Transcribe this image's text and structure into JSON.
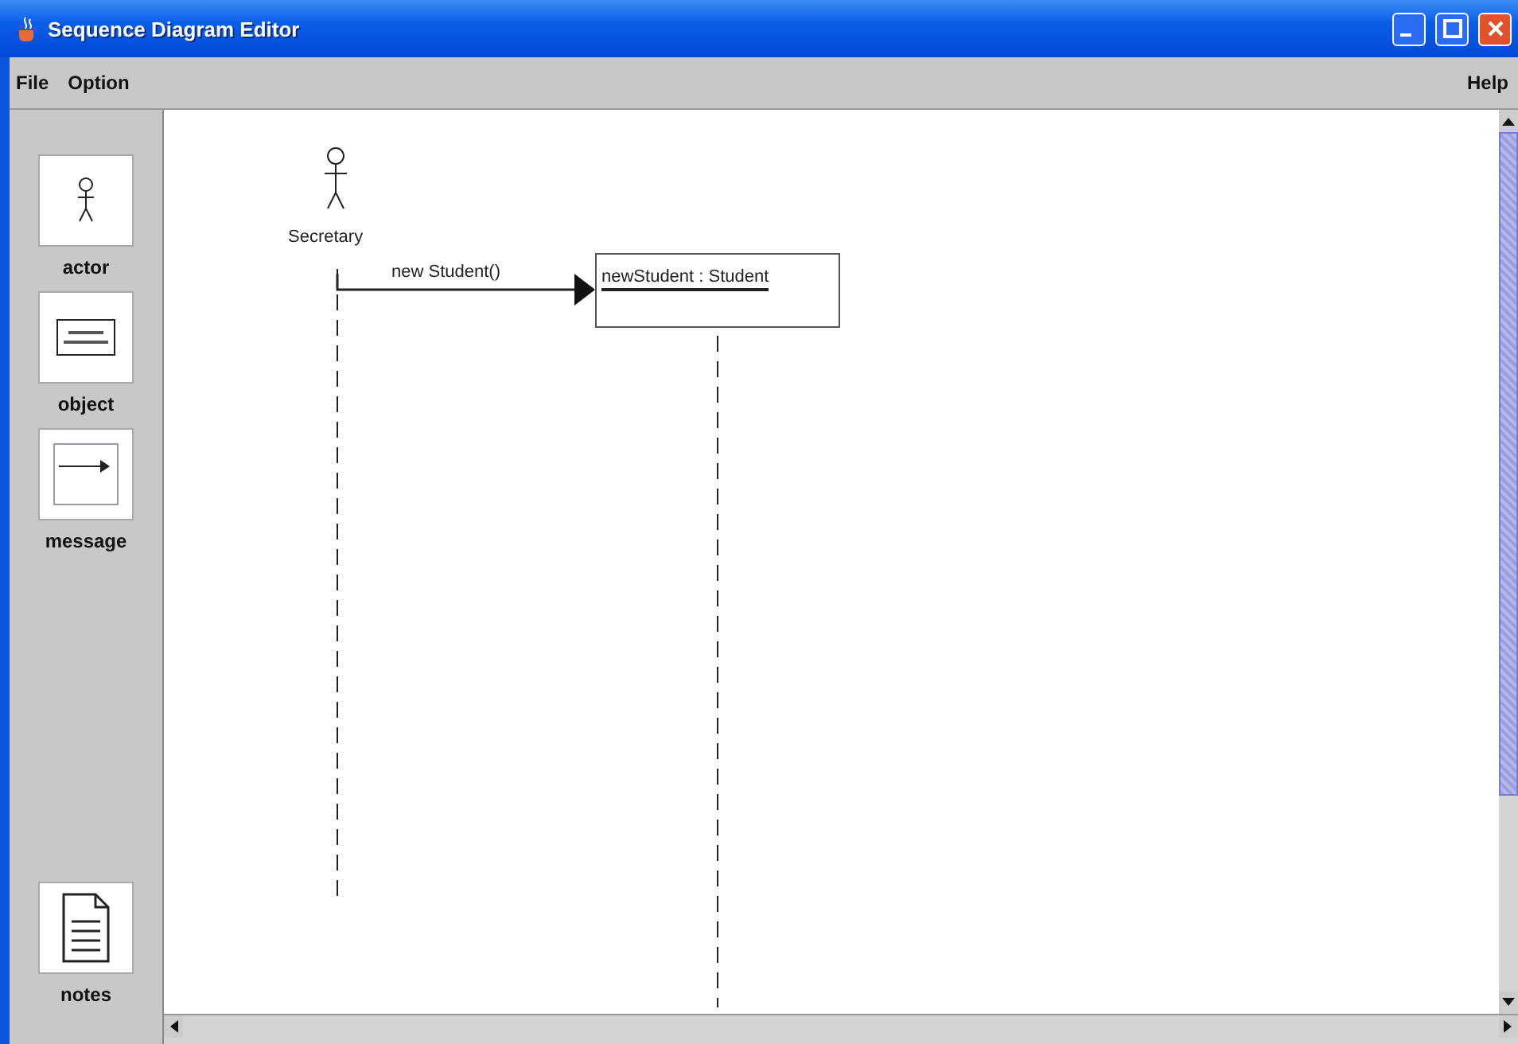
{
  "window": {
    "title": "Sequence Diagram Editor"
  },
  "menu_left": [
    "File",
    "Option"
  ],
  "menu_right": [
    "Help"
  ],
  "palette": [
    {
      "kind": "actor",
      "label": "actor"
    },
    {
      "kind": "object",
      "label": "object"
    },
    {
      "kind": "message",
      "label": "message"
    },
    {
      "kind": "notes",
      "label": "notes"
    }
  ],
  "diagram": {
    "actor": {
      "name": "Secretary"
    },
    "object": {
      "label": "newStudent : Student"
    },
    "message": {
      "label": "new Student()"
    }
  }
}
